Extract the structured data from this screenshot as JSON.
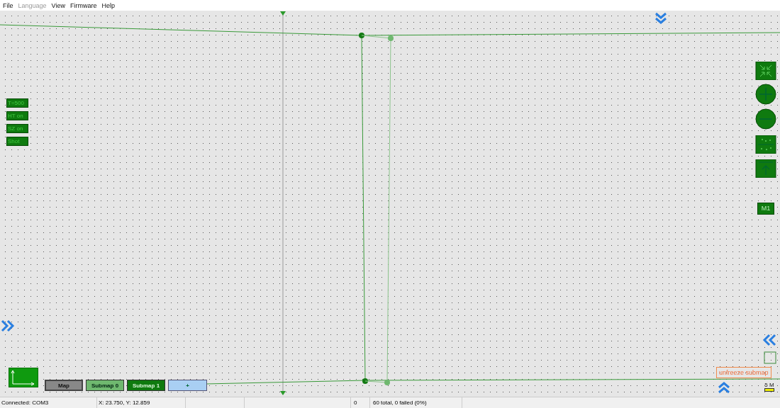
{
  "menu": [
    {
      "label": "File",
      "disabled": false
    },
    {
      "label": "Language",
      "disabled": true
    },
    {
      "label": "View",
      "disabled": false
    },
    {
      "label": "Firmware",
      "disabled": false
    },
    {
      "label": "Help",
      "disabled": false
    }
  ],
  "mode_labels": [
    "T=500",
    "HT on",
    "SZ on",
    "Shot"
  ],
  "marker_label": "M1",
  "map_tabs": [
    {
      "label": "Map",
      "kind": "map",
      "selected": true
    },
    {
      "label": "Submap 0",
      "kind": "submap",
      "selected": false,
      "color": "#6fb86f"
    },
    {
      "label": "Submap 1",
      "kind": "submap",
      "selected": false,
      "color": "#0f7a0f"
    },
    {
      "label": "+",
      "kind": "add",
      "selected": false
    }
  ],
  "unfreeze_button": "unfreeze submap",
  "scale_label": "5 M",
  "status_bar": {
    "connection": "Connected: COM3",
    "coordinates": "X: 23.750, Y: 12.859",
    "count": "0",
    "summary": "60 total, 0 failed (0%)"
  }
}
